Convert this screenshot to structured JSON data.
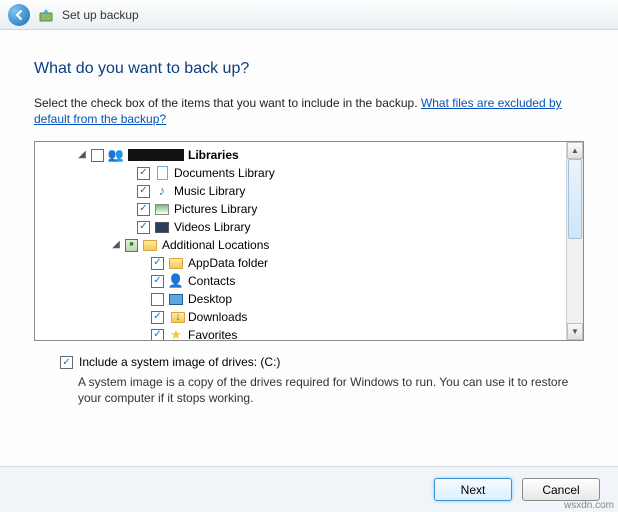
{
  "window": {
    "title": "Set up backup"
  },
  "heading": "What do you want to back up?",
  "description": "Select the check box of the items that you want to include in the backup. ",
  "help_link": "What files are excluded by default from the backup?",
  "tree": {
    "root_label": "Libraries",
    "libraries": [
      {
        "label": "Documents Library",
        "checked": true
      },
      {
        "label": "Music Library",
        "checked": true
      },
      {
        "label": "Pictures Library",
        "checked": true
      },
      {
        "label": "Videos Library",
        "checked": true
      }
    ],
    "additional_label": "Additional Locations",
    "additional": [
      {
        "label": "AppData folder",
        "checked": true
      },
      {
        "label": "Contacts",
        "checked": true
      },
      {
        "label": "Desktop",
        "checked": false
      },
      {
        "label": "Downloads",
        "checked": true
      },
      {
        "label": "Favorites",
        "checked": true
      }
    ]
  },
  "system_image": {
    "checkbox_label": "Include a system image of drives: (C:)",
    "description": "A system image is a copy of the drives required for Windows to run. You can use it to restore your computer if it stops working."
  },
  "buttons": {
    "next": "Next",
    "cancel": "Cancel"
  },
  "watermark": "wsxdn.com"
}
